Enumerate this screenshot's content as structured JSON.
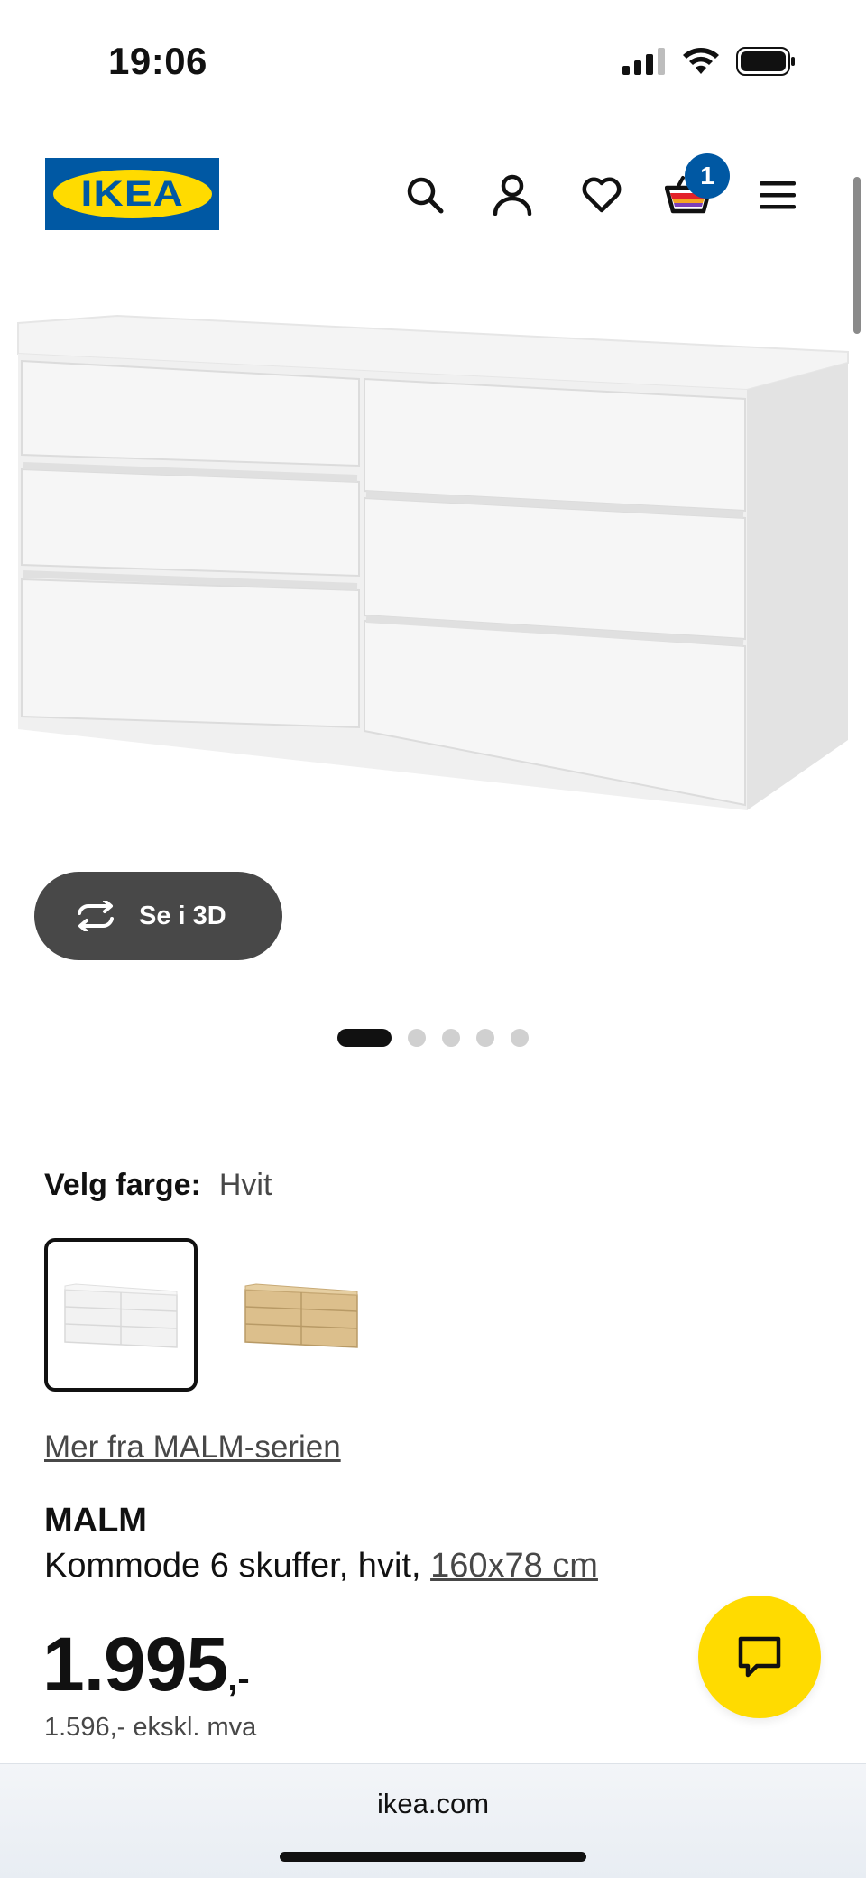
{
  "status_bar": {
    "time": "19:06"
  },
  "header": {
    "logo_text": "IKEA",
    "cart_count": "1",
    "icons": [
      "search-icon",
      "account-icon",
      "heart-icon",
      "cart-icon",
      "menu-icon"
    ]
  },
  "gallery": {
    "view_3d_label": "Se i 3D",
    "image_count": 5,
    "active_index": 0
  },
  "color_picker": {
    "label": "Velg farge:",
    "selected_value": "Hvit",
    "options": [
      "Hvit",
      "Eik"
    ]
  },
  "series_link": "Mer fra MALM-serien",
  "product": {
    "name": "MALM",
    "description": "Kommode 6 skuffer, hvit, ",
    "dimensions": "160x78 cm",
    "price": "1.995",
    "price_suffix": ",-",
    "price_ex_vat": "1.596,- ekskl. mva"
  },
  "browser": {
    "url": "ikea.com"
  },
  "colors": {
    "ikea_blue": "#0058a3",
    "ikea_yellow": "#ffdb00",
    "button_dark": "#484848"
  }
}
